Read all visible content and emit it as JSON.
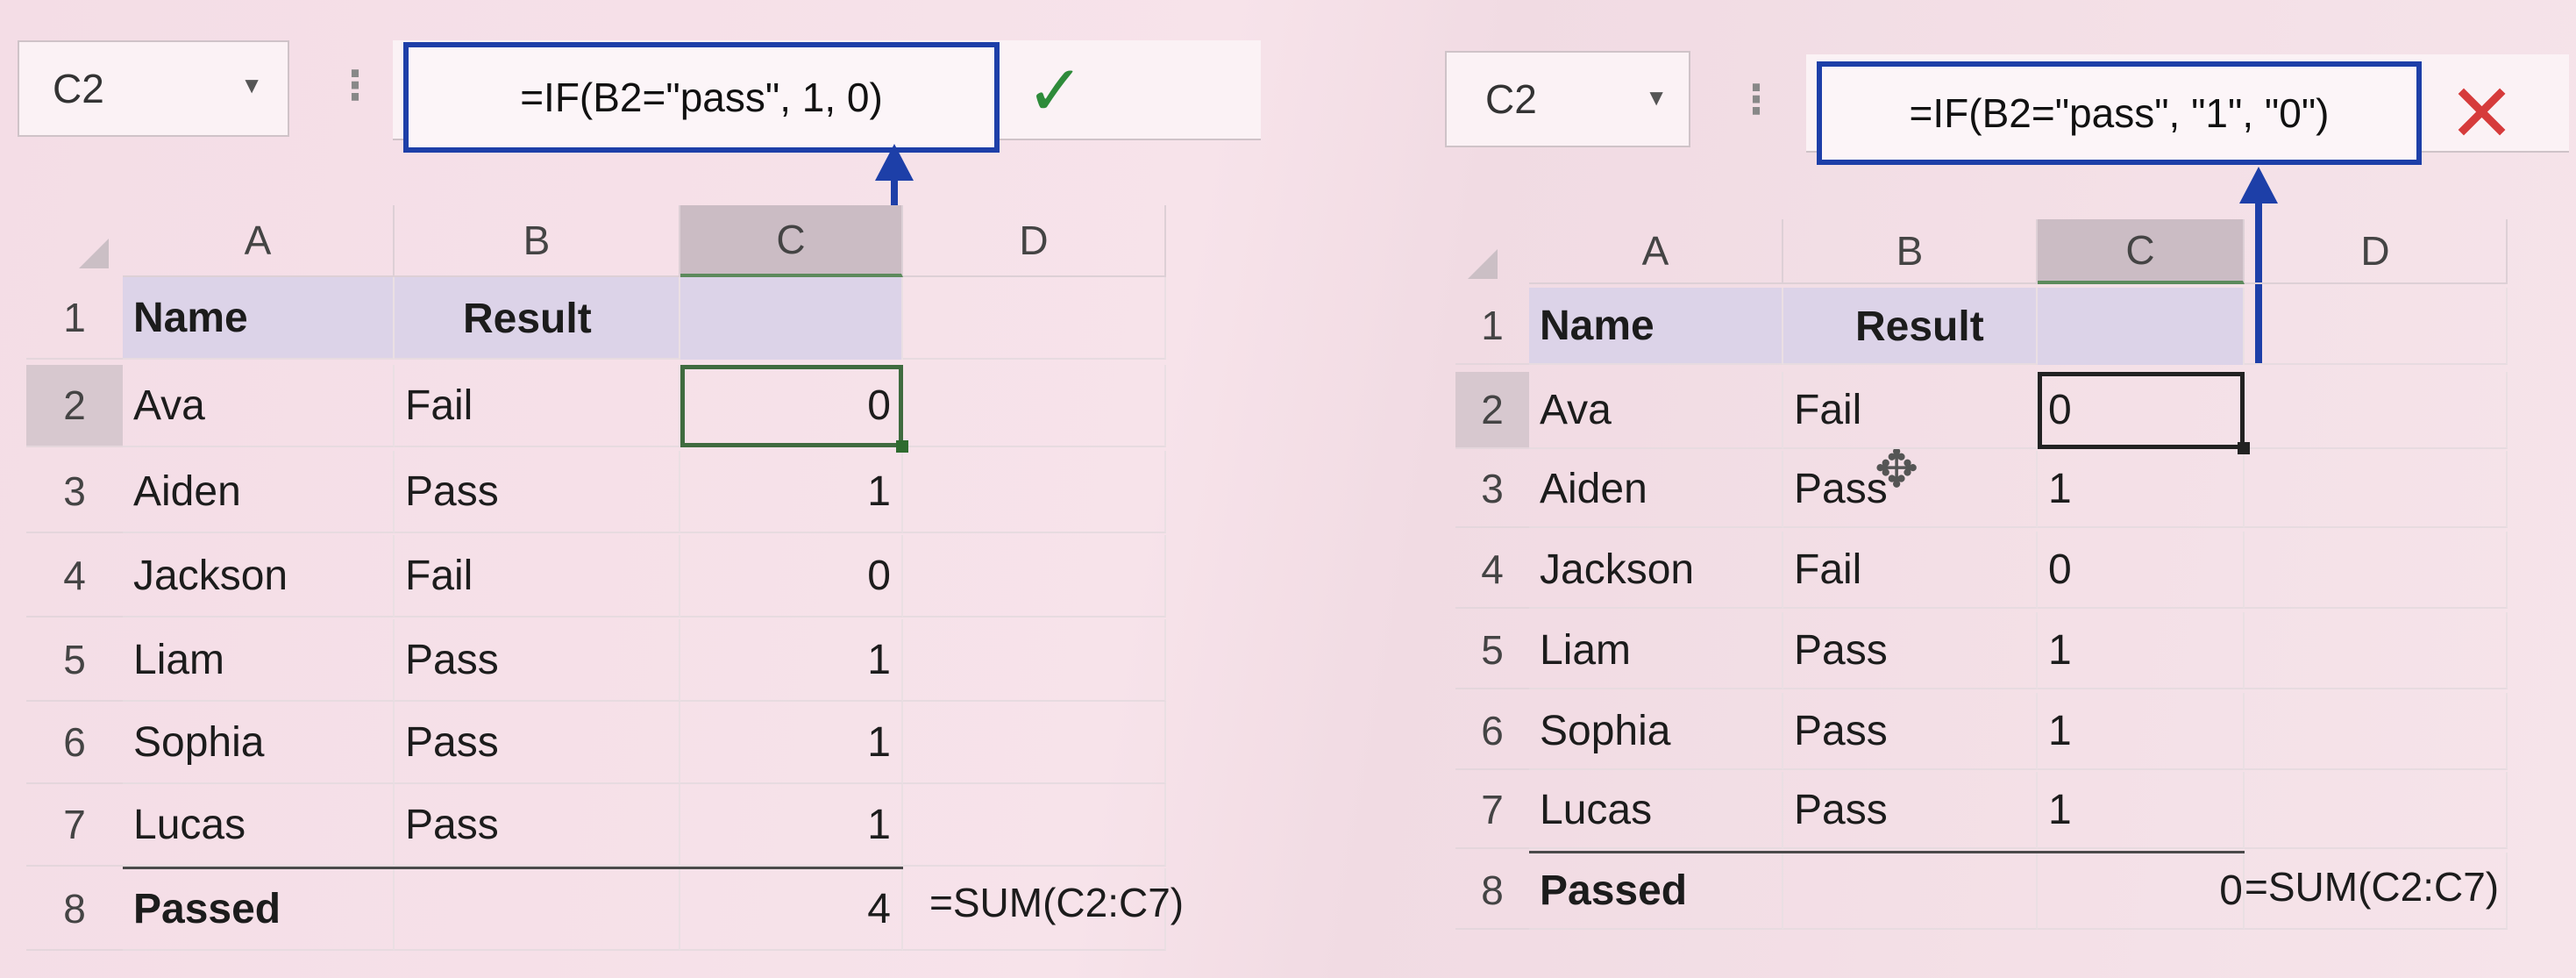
{
  "left": {
    "name_box": "C2",
    "formula": "=IF(B2=\"pass\", 1, 0)",
    "status_icon": "checkmark-icon",
    "columns": [
      "A",
      "B",
      "C",
      "D"
    ],
    "rows": [
      {
        "num": "1",
        "a": "Name",
        "b": "",
        "c": "Result",
        "header": true
      },
      {
        "num": "2",
        "a": "Ava",
        "b": "Fail",
        "c": "0"
      },
      {
        "num": "3",
        "a": "Aiden",
        "b": "Pass",
        "c": "1"
      },
      {
        "num": "4",
        "a": "Jackson",
        "b": "Fail",
        "c": "0"
      },
      {
        "num": "5",
        "a": "Liam",
        "b": "Pass",
        "c": "1"
      },
      {
        "num": "6",
        "a": "Sophia",
        "b": "Pass",
        "c": "1"
      },
      {
        "num": "7",
        "a": "Lucas",
        "b": "Pass",
        "c": "1"
      },
      {
        "num": "8",
        "a": "Passed",
        "b": "",
        "c": "4"
      }
    ],
    "annotation": "=SUM(C2:C7)"
  },
  "right": {
    "name_box": "C2",
    "formula": "=IF(B2=\"pass\", \"1\", \"0\")",
    "status_icon": "cross-icon",
    "columns": [
      "A",
      "B",
      "C",
      "D"
    ],
    "rows": [
      {
        "num": "1",
        "a": "Name",
        "b": "",
        "c": "Result",
        "header": true
      },
      {
        "num": "2",
        "a": "Ava",
        "b": "Fail",
        "c": "0"
      },
      {
        "num": "3",
        "a": "Aiden",
        "b": "Pass",
        "c": "1"
      },
      {
        "num": "4",
        "a": "Jackson",
        "b": "Fail",
        "c": "0"
      },
      {
        "num": "5",
        "a": "Liam",
        "b": "Pass",
        "c": "1"
      },
      {
        "num": "6",
        "a": "Sophia",
        "b": "Pass",
        "c": "1"
      },
      {
        "num": "7",
        "a": "Lucas",
        "b": "Pass",
        "c": "1"
      },
      {
        "num": "8",
        "a": "Passed",
        "b": "",
        "c": "0"
      }
    ],
    "annotation": "=SUM(C2:C7)"
  },
  "colors": {
    "highlight_box": "#1d3fa8",
    "check": "#2e8b3a",
    "cross": "#d63b3b",
    "header_band": "#dcd3e8"
  }
}
